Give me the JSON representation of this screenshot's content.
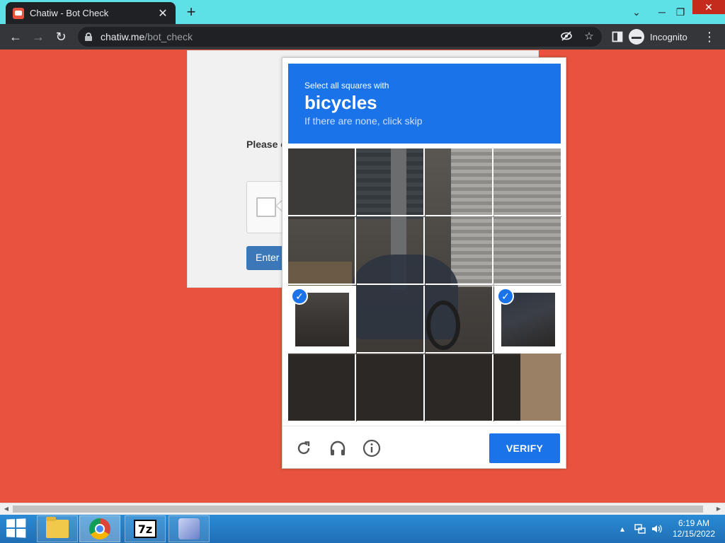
{
  "browser": {
    "tab_title": "Chatiw - Bot Check",
    "tab_close": "✕",
    "new_tab": "+",
    "url_host": "chatiw.me",
    "url_path": "/bot_check",
    "incognito_label": "Incognito",
    "window_controls": {
      "chevron": "⌄",
      "minimize": "─",
      "restore": "❐",
      "close": "✕"
    },
    "nav": {
      "back": "←",
      "forward": "→",
      "reload": "↻",
      "more": "⋮"
    }
  },
  "page": {
    "please_text": "Please c",
    "enter_button": "Enter"
  },
  "captcha": {
    "prompt_pre": "Select all squares with",
    "target": "bicycles",
    "prompt_sub": "If there are none, click skip",
    "selected_tiles": [
      9,
      12
    ],
    "checkmark": "✓",
    "verify_label": "VERIFY"
  },
  "taskbar": {
    "time": "6:19 AM",
    "date": "12/15/2022",
    "sevenzip_label": "7z",
    "tray_arrow": "▴"
  },
  "colors": {
    "page_background": "#e8533f",
    "titlebar": "#5de0e6",
    "captcha_blue": "#1a73e8"
  }
}
